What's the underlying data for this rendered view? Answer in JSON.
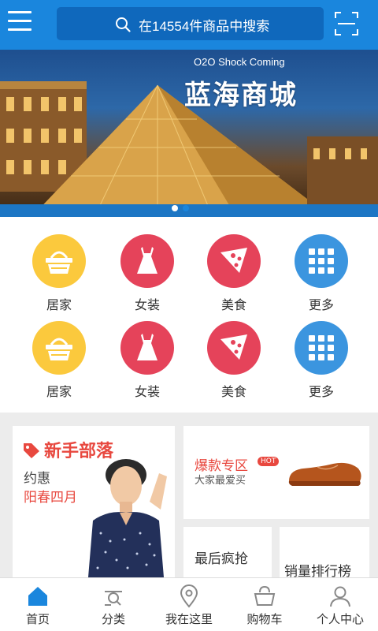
{
  "header": {
    "search_placeholder": "在14554件商品中搜索"
  },
  "banner": {
    "subtitle": "O2O Shock Coming",
    "title": "蓝海商城",
    "slides": 2,
    "active_slide": 2
  },
  "categories": [
    {
      "label": "居家",
      "icon": "basket-icon",
      "color": "#fbc93d"
    },
    {
      "label": "女装",
      "icon": "dress-icon",
      "color": "#e5435a"
    },
    {
      "label": "美食",
      "icon": "pizza-icon",
      "color": "#e5435a"
    },
    {
      "label": "更多",
      "icon": "grid-icon",
      "color": "#3b95df"
    },
    {
      "label": "居家",
      "icon": "basket-icon",
      "color": "#fbc93d"
    },
    {
      "label": "女装",
      "icon": "dress-icon",
      "color": "#e5435a"
    },
    {
      "label": "美食",
      "icon": "pizza-icon",
      "color": "#e5435a"
    },
    {
      "label": "更多",
      "icon": "grid-icon",
      "color": "#3b95df"
    }
  ],
  "promos": {
    "newbie": {
      "title": "新手部落",
      "line1": "约惠",
      "line2": "阳春四月"
    },
    "hot": {
      "title": "爆款专区",
      "badge": "HOT",
      "subtitle": "大家最爱买"
    },
    "last": {
      "title": "最后疯抢"
    },
    "rank": {
      "title": "销量排行榜"
    }
  },
  "tabs": [
    {
      "label": "首页",
      "icon": "home-icon",
      "active": true
    },
    {
      "label": "分类",
      "icon": "category-icon",
      "active": false
    },
    {
      "label": "我在这里",
      "icon": "location-icon",
      "active": false
    },
    {
      "label": "购物车",
      "icon": "cart-icon",
      "active": false
    },
    {
      "label": "个人中心",
      "icon": "user-icon",
      "active": false
    }
  ],
  "colors": {
    "brand_blue": "#1a86dd",
    "accent_red": "#e8483f"
  }
}
